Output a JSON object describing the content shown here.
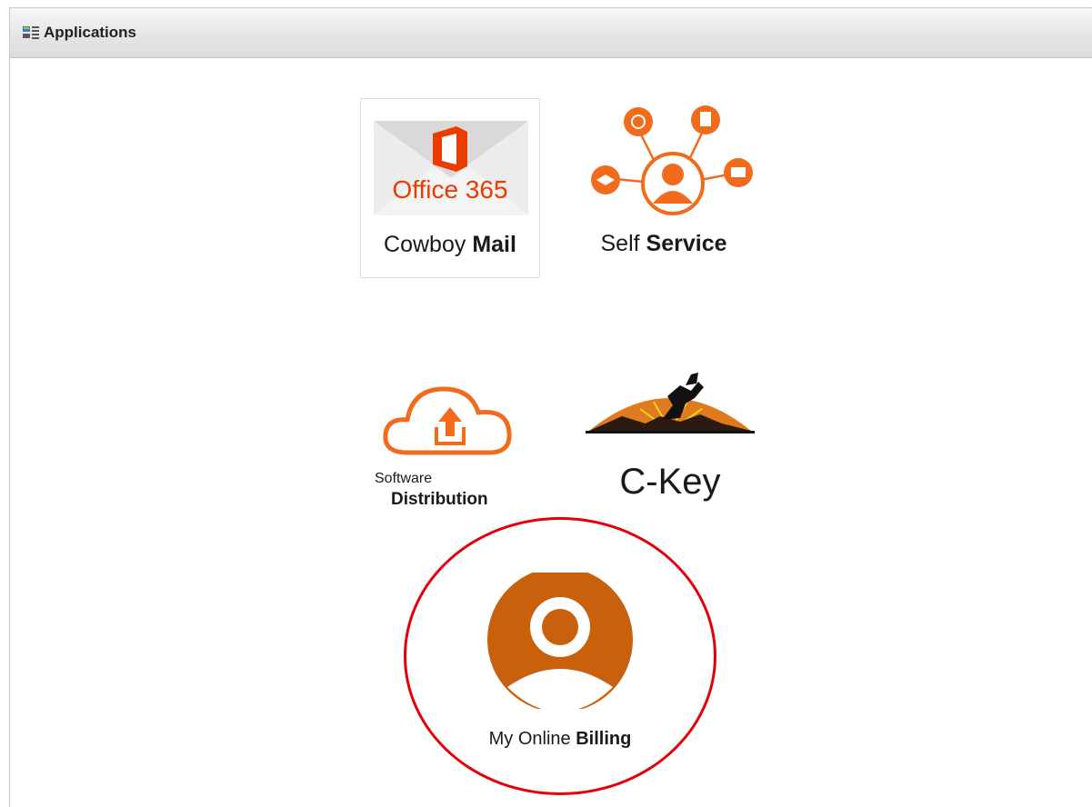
{
  "header": {
    "title": "Applications",
    "icon": "applications-list-icon"
  },
  "apps": {
    "mail": {
      "logo_text": "Office 365",
      "label_regular": "Cowboy ",
      "label_bold": "Mail",
      "icon": "office365-envelope-icon"
    },
    "self_service": {
      "label_regular": "Self ",
      "label_bold": "Service",
      "icon": "self-service-network-icon"
    },
    "software_distribution": {
      "label_top": "Software",
      "label_bold": "Distribution",
      "icon": "cloud-upload-icon"
    },
    "ckey": {
      "label": "C-Key",
      "icon": "bucking-bronco-sunset-icon"
    },
    "billing": {
      "label_regular": "My Online ",
      "label_bold": "Billing",
      "icon": "user-avatar-icon"
    }
  },
  "colors": {
    "accent_orange": "#f26b1d",
    "office_orange": "#eb3c00",
    "billing_orange": "#c8600c",
    "highlight_red": "#e3000b"
  }
}
